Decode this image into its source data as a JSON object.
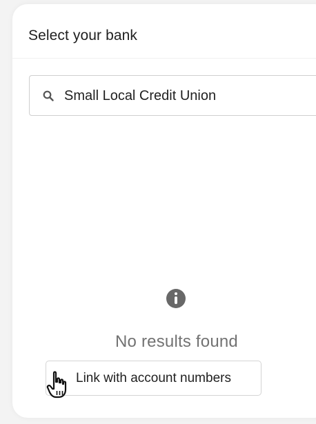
{
  "header": {
    "title": "Select your bank"
  },
  "search": {
    "value": "Small Local Credit Union",
    "icon": "search-icon"
  },
  "empty_state": {
    "icon": "info-icon",
    "message": "No results found"
  },
  "actions": {
    "link_account_numbers_label": "Link with account numbers"
  },
  "cursor": {
    "icon": "hand-pointer-icon"
  },
  "colors": {
    "background": "#f3f3f3",
    "card": "#ffffff",
    "border": "#cfcfcf",
    "muted_text": "#727272",
    "info_icon": "#686868"
  }
}
